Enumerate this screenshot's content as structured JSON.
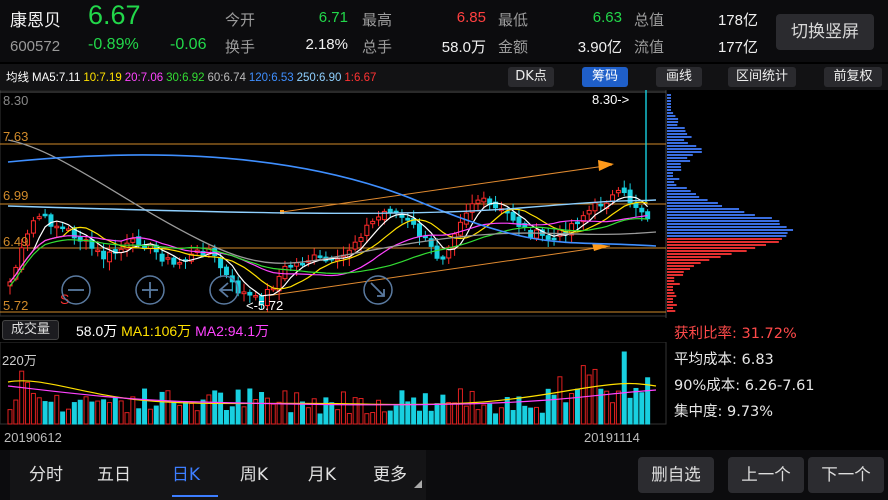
{
  "header": {
    "name": "康恩贝",
    "price": "6.67",
    "code": "600572",
    "change_pct": "-0.89%",
    "change_amt": "-0.06",
    "switch_label": "切换竖屏",
    "quotes": [
      {
        "label": "今开",
        "value": "6.71",
        "color": "#22d84a"
      },
      {
        "label": "最高",
        "value": "6.85",
        "color": "#ff4040"
      },
      {
        "label": "最低",
        "value": "6.63",
        "color": "#22d84a"
      },
      {
        "label": "总值",
        "value": "178亿",
        "color": "#f0f0f0"
      },
      {
        "label": "换手",
        "value": "2.18%",
        "color": "#f0f0f0"
      },
      {
        "label": "总手",
        "value": "58.0万",
        "color": "#f0f0f0"
      },
      {
        "label": "金额",
        "value": "3.90亿",
        "color": "#f0f0f0"
      },
      {
        "label": "流值",
        "value": "177亿",
        "color": "#f0f0f0"
      }
    ]
  },
  "toolbar": {
    "ma_items": [
      {
        "text": "均线",
        "color": "#ffffff"
      },
      {
        "text": "MA5:7.11",
        "color": "#ffffff"
      },
      {
        "text": "10:7.19",
        "color": "#ffe000"
      },
      {
        "text": "20:7.06",
        "color": "#ff44ff"
      },
      {
        "text": "30:6.92",
        "color": "#33dd33"
      },
      {
        "text": "60:6.74",
        "color": "#bbbbbb"
      },
      {
        "text": "120:6.53",
        "color": "#3f8fff"
      },
      {
        "text": "250:6.90",
        "color": "#8fd0ff"
      },
      {
        "text": "1:6.67",
        "color": "#ff3333"
      }
    ],
    "buttons": [
      "DK点",
      "筹码",
      "画线",
      "区间统计",
      "前复权"
    ],
    "active_button": "筹码"
  },
  "kline": {
    "price_labels": [
      "8.30",
      "7.63",
      "6.99",
      "6.49",
      "5.72"
    ],
    "peak_annotation": "8.30->",
    "low_annotation": "<-5.72",
    "marker": "S",
    "colors": {
      "up": "#ff2b2b",
      "down": "#18d0e0",
      "grid": "#d08a2a"
    }
  },
  "volume": {
    "label": "成交量",
    "legend": [
      {
        "text": "58.0万",
        "color": "#ffffff"
      },
      {
        "text": "MA1:106万",
        "color": "#ffe000"
      },
      {
        "text": "MA2:94.1万",
        "color": "#ff44ff"
      }
    ],
    "axis_max": "220万",
    "date_start": "20190612",
    "date_end": "20191114"
  },
  "chip": {
    "profit_ratio": "获利比率: 31.72%",
    "avg_cost": "平均成本: 6.83",
    "cost_90": "90%成本: 6.26-7.61",
    "concentration": "集中度: 9.73%",
    "colors": {
      "profit": "#3a6ee0",
      "loss": "#e23030",
      "profit_text": "#ff4a4a"
    }
  },
  "nav": {
    "tabs": [
      "分时",
      "五日",
      "日K",
      "周K",
      "月K",
      "更多"
    ],
    "active_tab": "日K",
    "buttons": [
      "删自选",
      "上一个",
      "下一个"
    ]
  }
}
